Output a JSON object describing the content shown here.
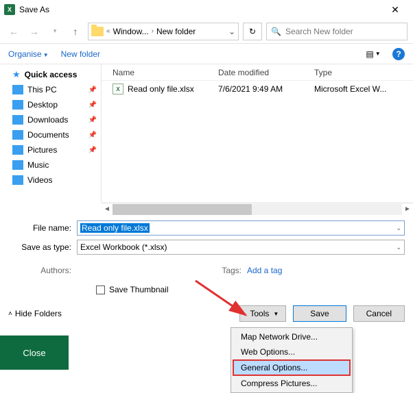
{
  "window": {
    "title": "Save As"
  },
  "breadcrumb": {
    "seg1": "Window...",
    "seg2": "New folder"
  },
  "search": {
    "placeholder": "Search New folder"
  },
  "toolbar": {
    "organise": "Organise",
    "newfolder": "New folder"
  },
  "sidebar": {
    "items": [
      {
        "label": "Quick access"
      },
      {
        "label": "This PC"
      },
      {
        "label": "Desktop"
      },
      {
        "label": "Downloads"
      },
      {
        "label": "Documents"
      },
      {
        "label": "Pictures"
      },
      {
        "label": "Music"
      },
      {
        "label": "Videos"
      }
    ]
  },
  "columns": {
    "name": "Name",
    "date": "Date modified",
    "type": "Type"
  },
  "files": [
    {
      "name": "Read only file.xlsx",
      "date": "7/6/2021 9:49 AM",
      "type": "Microsoft Excel W..."
    }
  ],
  "form": {
    "filename_label": "File name:",
    "filename_value": "Read only file.xlsx",
    "savetype_label": "Save as type:",
    "savetype_value": "Excel Workbook (*.xlsx)",
    "authors_label": "Authors:",
    "authors_value": "",
    "tags_label": "Tags:",
    "tags_link": "Add a tag",
    "thumb_label": "Save Thumbnail"
  },
  "buttons": {
    "hide_folders": "Hide Folders",
    "tools": "Tools",
    "save": "Save",
    "cancel": "Cancel",
    "close": "Close"
  },
  "tools_menu": {
    "items": [
      "Map Network Drive...",
      "Web Options...",
      "General Options...",
      "Compress Pictures..."
    ]
  }
}
